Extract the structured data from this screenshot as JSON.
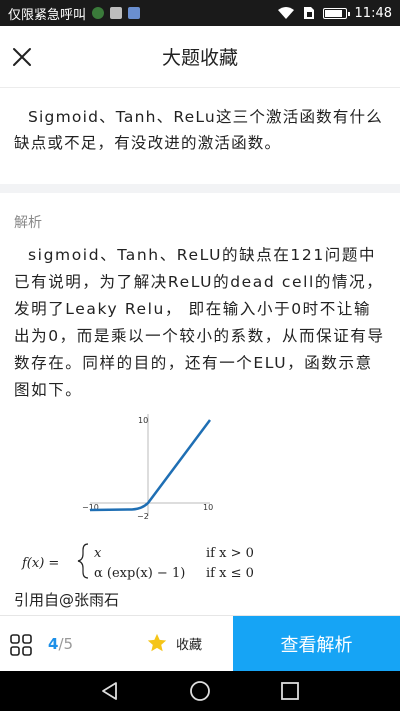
{
  "status_bar": {
    "carrier": "仅限紧急呼叫",
    "time": "11:48",
    "icons": [
      "notification-icon",
      "image-icon",
      "app-icon",
      "wifi-icon",
      "sim-icon",
      "battery-icon"
    ],
    "battery_level": 0.9
  },
  "header": {
    "title": "大题收藏",
    "close_icon": "close-icon"
  },
  "question": {
    "text": "Sigmoid、Tanh、ReLu这三个激活函数有什么缺点或不足，有没改进的激活函数。"
  },
  "analysis": {
    "label": "解析",
    "text": "sigmoid、Tanh、ReLU的缺点在121问题中已有说明，为了解决ReLU的dead cell的情况，发明了Leaky Relu， 即在输入小于0时不让输出为0，而是乘以一个较小的系数，从而保证有导数存在。同样的目的，还有一个ELU，函数示意图如下。",
    "citation": "引用自@张雨石"
  },
  "figure": {
    "tick_top": "10",
    "tick_left": "−10",
    "tick_right": "10",
    "tick_bottom": "−2",
    "formula": {
      "lhs": "f(x) =",
      "case1_expr": "x",
      "case1_cond": "if x > 0",
      "case2_expr": "α (exp(x) − 1)",
      "case2_cond": "if x ≤ 0"
    },
    "line_color": "#1f6fb4"
  },
  "actionbar": {
    "current_page": "4",
    "separator": "/",
    "total_pages": "5",
    "favorite_label": "收藏",
    "view_analysis_label": "查看解析",
    "accent_color": "#16a4f5"
  },
  "navbar": {
    "icons": [
      "back-icon",
      "home-icon",
      "recents-icon"
    ]
  }
}
